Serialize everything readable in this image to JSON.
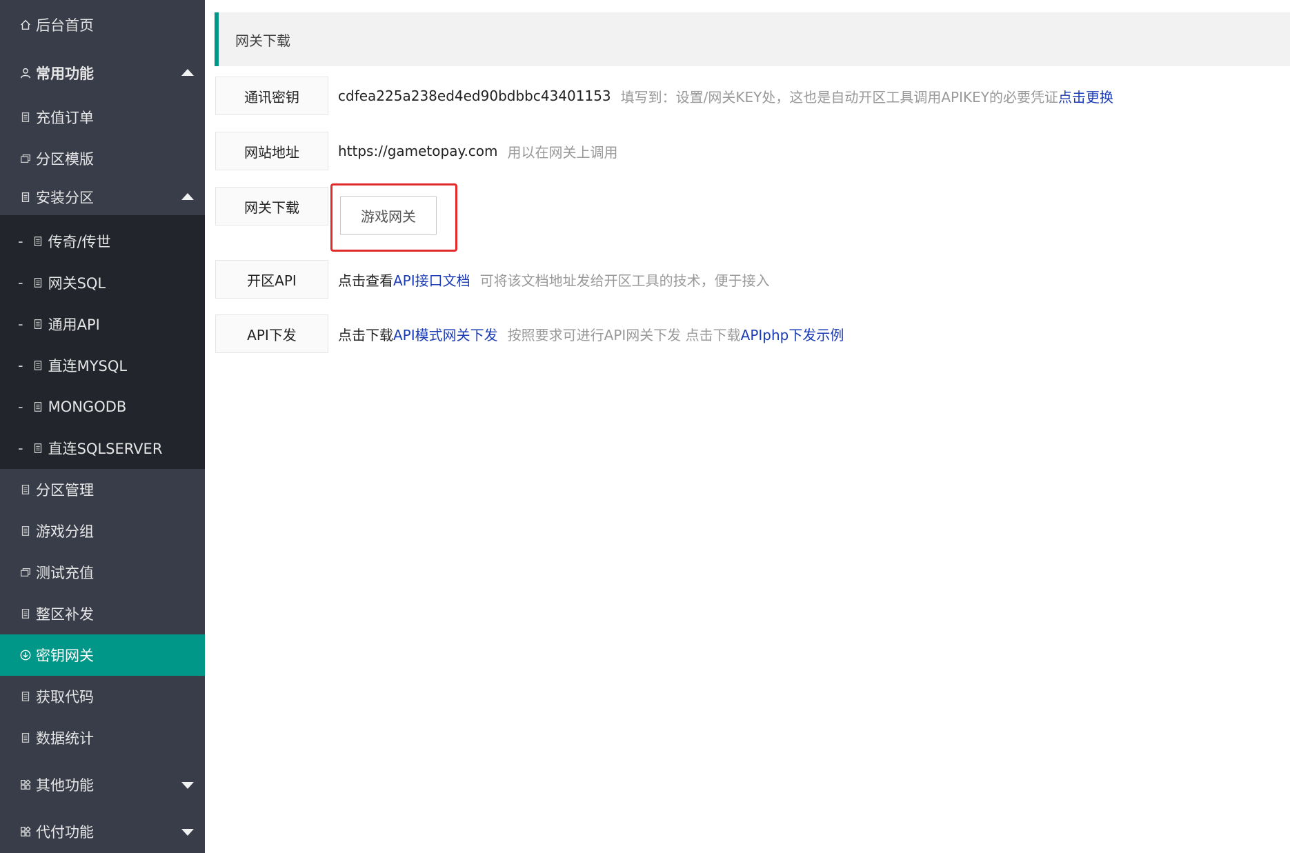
{
  "sidebar": {
    "home": "后台首页",
    "common": {
      "label": "常用功能",
      "items": [
        "充值订单",
        "分区模版"
      ]
    },
    "install": {
      "label": "安装分区",
      "children": [
        "传奇/传世",
        "网关SQL",
        "通用API",
        "直连MYSQL",
        "MONGODB",
        "直连SQLSERVER"
      ]
    },
    "items_after": [
      "分区管理",
      "游戏分组",
      "测试充值",
      "整区补发"
    ],
    "active": "密钥网关",
    "items_tail": [
      "获取代码",
      "数据统计"
    ],
    "other": "其他功能",
    "proxy": "代付功能",
    "child_prefix": "-"
  },
  "main": {
    "title": "网关下载",
    "rows": {
      "key": {
        "label": "通讯密钥",
        "value": "cdfea225a238ed4ed90bdbbc43401153",
        "note": "填写到：设置/网关KEY处，这也是自动开区工具调用APIKEY的必要凭证",
        "link": "点击更换"
      },
      "site": {
        "label": "网站地址",
        "value": "https://gametopay.com",
        "note": "用以在网关上调用"
      },
      "download": {
        "label": "网关下载",
        "button": "游戏网关"
      },
      "api": {
        "label": "开区API",
        "prefix": "点击查看",
        "link": "API接口文档",
        "note": "可将该文档地址发给开区工具的技术，便于接入"
      },
      "dispatch": {
        "label": "API下发",
        "prefix": "点击下载",
        "link": "API模式网关下发",
        "note": "按照要求可进行API网关下发 点击下载",
        "link2": "APIphp下发示例"
      }
    }
  },
  "colors": {
    "sidebar_bg": "#393d49",
    "sidebar_deep": "#22252c",
    "accent": "#009688",
    "link": "#1a3bb5",
    "highlight": "#e32a2a"
  }
}
